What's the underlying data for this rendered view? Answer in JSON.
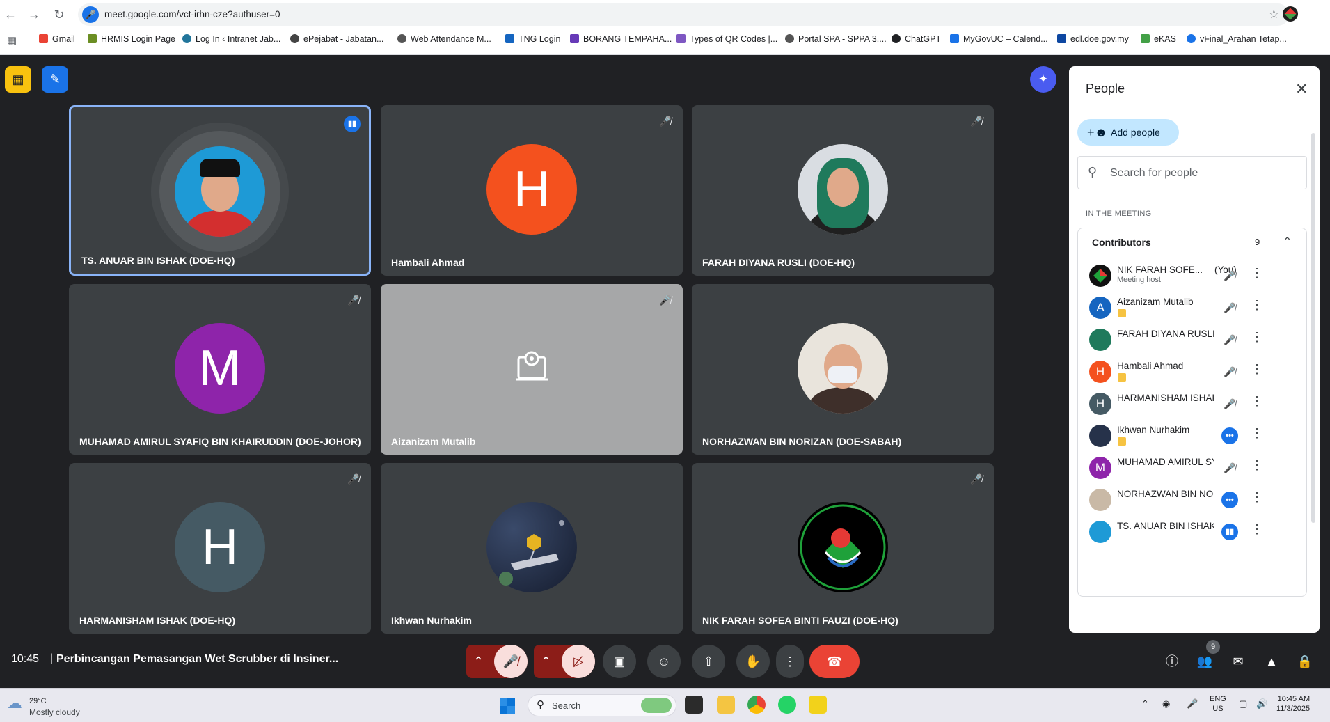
{
  "browser": {
    "url": "meet.google.com/vct-irhn-cze?authuser=0",
    "bookmarks": [
      {
        "label": "Gmail",
        "color": "#ea4335"
      },
      {
        "label": "HRMIS Login Page",
        "color": "#6b8e23"
      },
      {
        "label": "Log In ‹ Intranet Jab...",
        "color": "#21759b"
      },
      {
        "label": "ePejabat - Jabatan...",
        "color": "#444444"
      },
      {
        "label": "Web Attendance M...",
        "color": "#555555"
      },
      {
        "label": "TNG Login",
        "color": "#1565c0"
      },
      {
        "label": "BORANG TEMPAHA...",
        "color": "#673ab7"
      },
      {
        "label": "Types of QR Codes |...",
        "color": "#7e57c2"
      },
      {
        "label": "Portal SPA - SPPA 3....",
        "color": "#555555"
      },
      {
        "label": "ChatGPT",
        "color": "#202124"
      },
      {
        "label": "MyGovUC – Calend...",
        "color": "#1a73e8"
      },
      {
        "label": "edl.doe.gov.my",
        "color": "#0d47a1"
      },
      {
        "label": "eKAS",
        "color": "#43a047"
      },
      {
        "label": "vFinal_Arahan Tetap...",
        "color": "#1a73e8"
      }
    ]
  },
  "tiles": [
    {
      "name": "TS. ANUAR BIN ISHAK (DOE-HQ)",
      "initial": "",
      "status": "speaking"
    },
    {
      "name": "Hambali Ahmad",
      "initial": "H",
      "status": "muted"
    },
    {
      "name": "FARAH DIYANA RUSLI (DOE-HQ)",
      "initial": "",
      "status": "muted"
    },
    {
      "name": "MUHAMAD AMIRUL SYAFIQ BIN KHAIRUDDIN (DOE-JOHOR)",
      "initial": "M",
      "status": "muted"
    },
    {
      "name": "Aizanizam Mutalib",
      "initial": "",
      "status": "muted"
    },
    {
      "name": "NORHAZWAN BIN NORIZAN (DOE-SABAH)",
      "initial": "",
      "status": "none"
    },
    {
      "name": "HARMANISHAM ISHAK (DOE-HQ)",
      "initial": "H",
      "status": "muted"
    },
    {
      "name": "Ikhwan Nurhakim",
      "initial": "",
      "status": "none"
    },
    {
      "name": "NIK FARAH SOFEA BINTI FAUZI (DOE-HQ)",
      "initial": "",
      "status": "muted"
    }
  ],
  "colors": {
    "hambali": "#f4511e",
    "amirul": "#8e24aa",
    "harmanisham": "#455a64",
    "aizanizam_panel": "#1565c0"
  },
  "meeting": {
    "time": "10:45",
    "separator": "|",
    "title": "Perbincangan Pemasangan Wet Scrubber di Insiner..."
  },
  "people_panel": {
    "title": "People",
    "add_label": "Add people",
    "search_placeholder": "Search for people",
    "section_label": "IN THE MEETING",
    "group_title": "Contributors",
    "group_count": "9",
    "participant_badge": "9",
    "people": [
      {
        "name": "NIK FARAH SOFE...",
        "you": "(You)",
        "sub": "Meeting host",
        "badge": false,
        "mic": "muted"
      },
      {
        "name": "Aizanizam Mutalib",
        "you": "",
        "sub": "",
        "badge": true,
        "mic": "muted"
      },
      {
        "name": "FARAH DIYANA RUSLI (...",
        "you": "",
        "sub": "",
        "badge": false,
        "mic": "muted"
      },
      {
        "name": "Hambali Ahmad",
        "you": "",
        "sub": "",
        "badge": true,
        "mic": "muted"
      },
      {
        "name": "HARMANISHAM ISHAK ...",
        "you": "",
        "sub": "",
        "badge": false,
        "mic": "muted"
      },
      {
        "name": "Ikhwan Nurhakim",
        "you": "",
        "sub": "",
        "badge": true,
        "mic": "dots"
      },
      {
        "name": "MUHAMAD AMIRUL SY...",
        "you": "",
        "sub": "",
        "badge": false,
        "mic": "muted"
      },
      {
        "name": "NORHAZWAN BIN NORI...",
        "you": "",
        "sub": "",
        "badge": false,
        "mic": "dots"
      },
      {
        "name": "TS. ANUAR BIN ISHAK (...",
        "you": "",
        "sub": "",
        "badge": false,
        "mic": "speaking"
      }
    ],
    "avatar_initials": [
      "",
      "A",
      "",
      "H",
      "H",
      "",
      "M",
      "",
      ""
    ]
  },
  "taskbar": {
    "temperature": "29°C",
    "weather": "Mostly cloudy",
    "search_placeholder": "Search",
    "lang_top": "ENG",
    "lang_bottom": "US",
    "time": "10:45 AM",
    "date": "11/3/2025"
  }
}
